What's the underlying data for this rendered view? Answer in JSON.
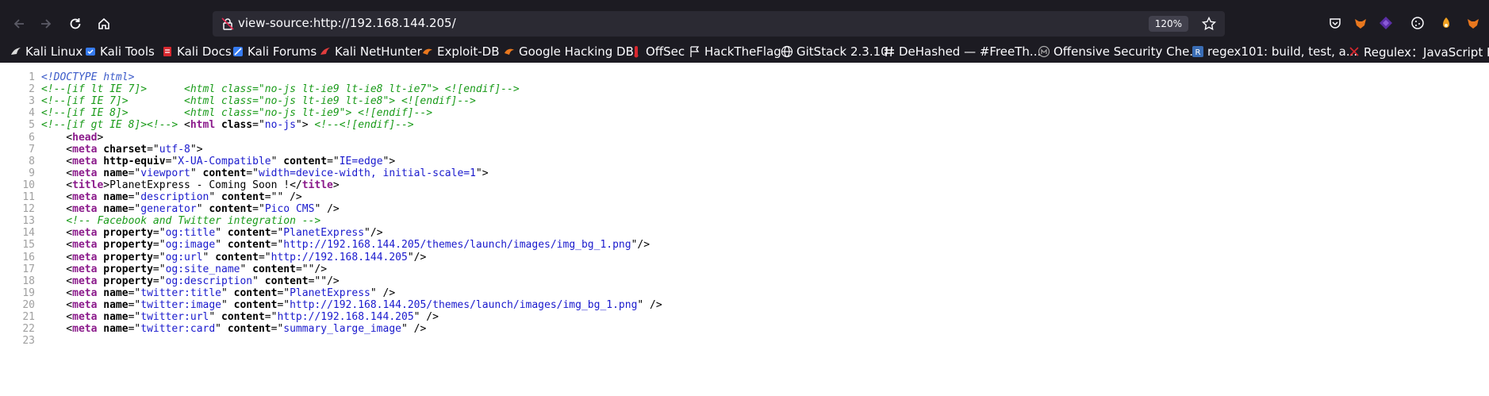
{
  "browser": {
    "url": "view-source:http://192.168.144.205/",
    "zoom": "120%",
    "bookmarks": [
      {
        "label": "Kali Linux",
        "icon": "kali-dragon-icon"
      },
      {
        "label": "Kali Tools",
        "icon": "kali-tools-icon"
      },
      {
        "label": "Kali Docs",
        "icon": "kali-docs-icon"
      },
      {
        "label": "Kali Forums",
        "icon": "kali-forums-icon"
      },
      {
        "label": "Kali NetHunter",
        "icon": "nethunter-icon"
      },
      {
        "label": "Exploit-DB",
        "icon": "exploit-db-icon"
      },
      {
        "label": "Google Hacking DB",
        "icon": "ghdb-icon"
      },
      {
        "label": "OffSec",
        "icon": "offsec-icon"
      },
      {
        "label": "HackTheFlag",
        "icon": "flag-icon"
      },
      {
        "label": "GitStack 2.3.10",
        "icon": "globe-icon"
      },
      {
        "label": "DeHashed — #FreeTh...",
        "icon": "hash-icon"
      },
      {
        "label": "Offensive Security Che...",
        "icon": "cheatsheet-icon"
      },
      {
        "label": "regex101: build, test, a...",
        "icon": "regex101-icon"
      },
      {
        "label": "Regulex：JavaScript R...",
        "icon": "regulex-icon"
      }
    ]
  },
  "source_lines": [
    {
      "n": "1",
      "segs": [
        [
          "dt",
          "<!DOCTYPE html>"
        ]
      ]
    },
    {
      "n": "2",
      "segs": [
        [
          "cm",
          "<!--[if lt IE 7]>      <html class=\"no-js lt-ie9 lt-ie8 lt-ie7\"> <![endif]-->"
        ]
      ]
    },
    {
      "n": "3",
      "segs": [
        [
          "cm",
          "<!--[if IE 7]>         <html class=\"no-js lt-ie9 lt-ie8\"> <![endif]-->"
        ]
      ]
    },
    {
      "n": "4",
      "segs": [
        [
          "cm",
          "<!--[if IE 8]>         <html class=\"no-js lt-ie9\"> <![endif]-->"
        ]
      ]
    },
    {
      "n": "5",
      "segs": [
        [
          "cm",
          "<!--[if gt IE 8]><!-->"
        ],
        [
          "pl",
          " <"
        ],
        [
          "tg",
          "html"
        ],
        [
          "pl",
          " "
        ],
        [
          "at",
          "class"
        ],
        [
          "pl",
          "=\""
        ],
        [
          "vl",
          "no-js"
        ],
        [
          "pl",
          "\"> "
        ],
        [
          "cm",
          "<!--<![endif]-->"
        ]
      ]
    },
    {
      "n": "6",
      "segs": [
        [
          "pl",
          "    <"
        ],
        [
          "tg",
          "head"
        ],
        [
          "pl",
          ">"
        ]
      ]
    },
    {
      "n": "7",
      "segs": [
        [
          "pl",
          "    <"
        ],
        [
          "tg",
          "meta"
        ],
        [
          "pl",
          " "
        ],
        [
          "at",
          "charset"
        ],
        [
          "pl",
          "=\""
        ],
        [
          "vl",
          "utf-8"
        ],
        [
          "pl",
          "\">"
        ]
      ]
    },
    {
      "n": "8",
      "segs": [
        [
          "pl",
          "    <"
        ],
        [
          "tg",
          "meta"
        ],
        [
          "pl",
          " "
        ],
        [
          "at",
          "http-equiv"
        ],
        [
          "pl",
          "=\""
        ],
        [
          "vl",
          "X-UA-Compatible"
        ],
        [
          "pl",
          "\" "
        ],
        [
          "at",
          "content"
        ],
        [
          "pl",
          "=\""
        ],
        [
          "vl",
          "IE=edge"
        ],
        [
          "pl",
          "\">"
        ]
      ]
    },
    {
      "n": "9",
      "segs": [
        [
          "pl",
          "    <"
        ],
        [
          "tg",
          "meta"
        ],
        [
          "pl",
          " "
        ],
        [
          "at",
          "name"
        ],
        [
          "pl",
          "=\""
        ],
        [
          "vl",
          "viewport"
        ],
        [
          "pl",
          "\" "
        ],
        [
          "at",
          "content"
        ],
        [
          "pl",
          "=\""
        ],
        [
          "vl",
          "width=device-width, initial-scale=1"
        ],
        [
          "pl",
          "\">"
        ]
      ]
    },
    {
      "n": "10",
      "segs": [
        [
          "pl",
          "    <"
        ],
        [
          "tg",
          "title"
        ],
        [
          "pl",
          ">PlanetExpress - Coming Soon !</"
        ],
        [
          "tg",
          "title"
        ],
        [
          "pl",
          ">"
        ]
      ]
    },
    {
      "n": "11",
      "segs": [
        [
          "pl",
          "    <"
        ],
        [
          "tg",
          "meta"
        ],
        [
          "pl",
          " "
        ],
        [
          "at",
          "name"
        ],
        [
          "pl",
          "=\""
        ],
        [
          "vl",
          "description"
        ],
        [
          "pl",
          "\" "
        ],
        [
          "at",
          "content"
        ],
        [
          "pl",
          "=\"\" />"
        ]
      ]
    },
    {
      "n": "12",
      "segs": [
        [
          "pl",
          "    <"
        ],
        [
          "tg",
          "meta"
        ],
        [
          "pl",
          " "
        ],
        [
          "at",
          "name"
        ],
        [
          "pl",
          "=\""
        ],
        [
          "vl",
          "generator"
        ],
        [
          "pl",
          "\" "
        ],
        [
          "at",
          "content"
        ],
        [
          "pl",
          "=\""
        ],
        [
          "vl",
          "Pico CMS"
        ],
        [
          "pl",
          "\" />"
        ]
      ]
    },
    {
      "n": "13",
      "segs": [
        [
          "pl",
          "    "
        ],
        [
          "cm",
          "<!-- Facebook and Twitter integration -->"
        ]
      ]
    },
    {
      "n": "14",
      "segs": [
        [
          "pl",
          "    <"
        ],
        [
          "tg",
          "meta"
        ],
        [
          "pl",
          " "
        ],
        [
          "at",
          "property"
        ],
        [
          "pl",
          "=\""
        ],
        [
          "vl",
          "og:title"
        ],
        [
          "pl",
          "\" "
        ],
        [
          "at",
          "content"
        ],
        [
          "pl",
          "=\""
        ],
        [
          "vl",
          "PlanetExpress"
        ],
        [
          "pl",
          "\"/>"
        ]
      ]
    },
    {
      "n": "15",
      "segs": [
        [
          "pl",
          "    <"
        ],
        [
          "tg",
          "meta"
        ],
        [
          "pl",
          " "
        ],
        [
          "at",
          "property"
        ],
        [
          "pl",
          "=\""
        ],
        [
          "vl",
          "og:image"
        ],
        [
          "pl",
          "\" "
        ],
        [
          "at",
          "content"
        ],
        [
          "pl",
          "=\""
        ],
        [
          "vl",
          "http://192.168.144.205/themes/launch/images/img_bg_1.png"
        ],
        [
          "pl",
          "\"/>"
        ]
      ]
    },
    {
      "n": "16",
      "segs": [
        [
          "pl",
          "    <"
        ],
        [
          "tg",
          "meta"
        ],
        [
          "pl",
          " "
        ],
        [
          "at",
          "property"
        ],
        [
          "pl",
          "=\""
        ],
        [
          "vl",
          "og:url"
        ],
        [
          "pl",
          "\" "
        ],
        [
          "at",
          "content"
        ],
        [
          "pl",
          "=\""
        ],
        [
          "vl",
          "http://192.168.144.205"
        ],
        [
          "pl",
          "\"/>"
        ]
      ]
    },
    {
      "n": "17",
      "segs": [
        [
          "pl",
          "    <"
        ],
        [
          "tg",
          "meta"
        ],
        [
          "pl",
          " "
        ],
        [
          "at",
          "property"
        ],
        [
          "pl",
          "=\""
        ],
        [
          "vl",
          "og:site_name"
        ],
        [
          "pl",
          "\" "
        ],
        [
          "at",
          "content"
        ],
        [
          "pl",
          "=\"\"/>"
        ]
      ]
    },
    {
      "n": "18",
      "segs": [
        [
          "pl",
          "    <"
        ],
        [
          "tg",
          "meta"
        ],
        [
          "pl",
          " "
        ],
        [
          "at",
          "property"
        ],
        [
          "pl",
          "=\""
        ],
        [
          "vl",
          "og:description"
        ],
        [
          "pl",
          "\" "
        ],
        [
          "at",
          "content"
        ],
        [
          "pl",
          "=\"\"/>"
        ]
      ]
    },
    {
      "n": "19",
      "segs": [
        [
          "pl",
          "    <"
        ],
        [
          "tg",
          "meta"
        ],
        [
          "pl",
          " "
        ],
        [
          "at",
          "name"
        ],
        [
          "pl",
          "=\""
        ],
        [
          "vl",
          "twitter:title"
        ],
        [
          "pl",
          "\" "
        ],
        [
          "at",
          "content"
        ],
        [
          "pl",
          "=\""
        ],
        [
          "vl",
          "PlanetExpress"
        ],
        [
          "pl",
          "\" />"
        ]
      ]
    },
    {
      "n": "20",
      "segs": [
        [
          "pl",
          "    <"
        ],
        [
          "tg",
          "meta"
        ],
        [
          "pl",
          " "
        ],
        [
          "at",
          "name"
        ],
        [
          "pl",
          "=\""
        ],
        [
          "vl",
          "twitter:image"
        ],
        [
          "pl",
          "\" "
        ],
        [
          "at",
          "content"
        ],
        [
          "pl",
          "=\""
        ],
        [
          "vl",
          "http://192.168.144.205/themes/launch/images/img_bg_1.png"
        ],
        [
          "pl",
          "\" />"
        ]
      ]
    },
    {
      "n": "21",
      "segs": [
        [
          "pl",
          "    <"
        ],
        [
          "tg",
          "meta"
        ],
        [
          "pl",
          " "
        ],
        [
          "at",
          "name"
        ],
        [
          "pl",
          "=\""
        ],
        [
          "vl",
          "twitter:url"
        ],
        [
          "pl",
          "\" "
        ],
        [
          "at",
          "content"
        ],
        [
          "pl",
          "=\""
        ],
        [
          "vl",
          "http://192.168.144.205"
        ],
        [
          "pl",
          "\" />"
        ]
      ]
    },
    {
      "n": "22",
      "segs": [
        [
          "pl",
          "    <"
        ],
        [
          "tg",
          "meta"
        ],
        [
          "pl",
          " "
        ],
        [
          "at",
          "name"
        ],
        [
          "pl",
          "=\""
        ],
        [
          "vl",
          "twitter:card"
        ],
        [
          "pl",
          "\" "
        ],
        [
          "at",
          "content"
        ],
        [
          "pl",
          "=\""
        ],
        [
          "vl",
          "summary_large_image"
        ],
        [
          "pl",
          "\" />"
        ]
      ]
    },
    {
      "n": "23",
      "segs": []
    }
  ]
}
